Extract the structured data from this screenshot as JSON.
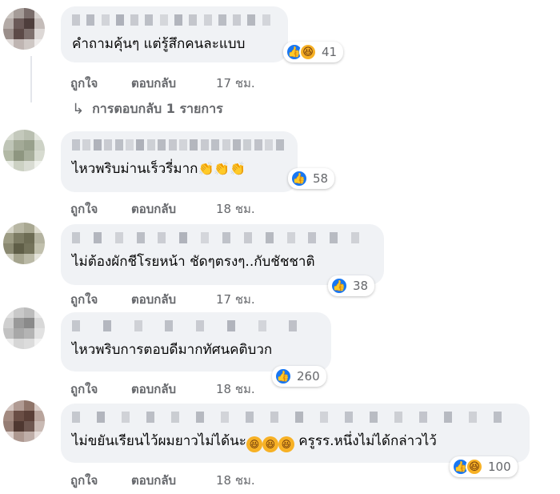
{
  "comments": [
    {
      "text": "คำถามคุ้นๆ แต่รู้สึกคนละแบบ",
      "reaction_count": "41",
      "like_label": "ถูกใจ",
      "reply_label": "ตอบกลับ",
      "time": "17 ชม.",
      "reactions": [
        "like",
        "haha"
      ]
    },
    {
      "text": "ไหวพริบม่านเร็วรี่มาก",
      "emoji_suffix": "👏👏👏",
      "reaction_count": "58",
      "like_label": "ถูกใจ",
      "reply_label": "ตอบกลับ",
      "time": "18 ชม.",
      "reactions": [
        "like"
      ]
    },
    {
      "text": "ไม่ต้องผักชีโรยหน้า ชัดๆตรงๆ..กับชัชชาติ",
      "reaction_count": "38",
      "like_label": "ถูกใจ",
      "reply_label": "ตอบกลับ",
      "time": "17 ชม.",
      "reactions": [
        "like"
      ]
    },
    {
      "text": "ไหวพริบการตอบดีมากทัศนคติบวก",
      "reaction_count": "260",
      "like_label": "ถูกใจ",
      "reply_label": "ตอบกลับ",
      "time": "18 ชม.",
      "reactions": [
        "like"
      ]
    },
    {
      "text_before": "ไม่ขยันเรียนไว้ผมยาวไม่ได้นะ",
      "text_after": " ครูรร.หนึ่งไม่ได้กล่าวไว้",
      "reaction_count": "100",
      "like_label": "ถูกใจ",
      "reply_label": "ตอบกลับ",
      "time": "18 ชม.",
      "reactions": [
        "like",
        "haha"
      ]
    }
  ],
  "replies_link": "การตอบกลับ 1 รายการ",
  "icons": {
    "like": "thumbs-up-icon",
    "haha": "laughing-face-icon",
    "reply_arrow": "reply-arrow-icon"
  },
  "colors": {
    "bubble_bg": "#f0f2f5",
    "like_blue": "#1877f2",
    "haha_yellow": "#f7b125",
    "meta_gray": "#65676b"
  }
}
